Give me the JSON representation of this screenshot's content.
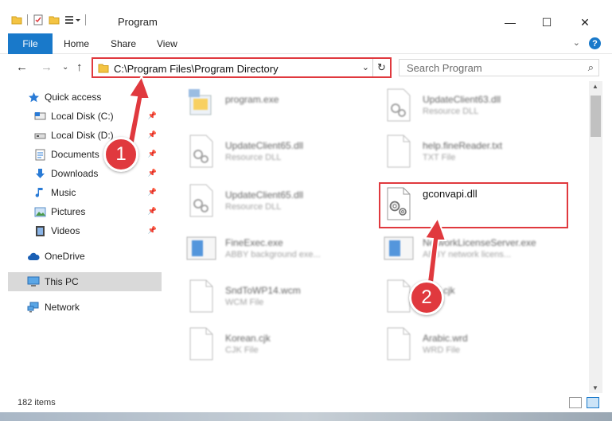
{
  "window": {
    "title": "Program",
    "minimize": "—",
    "maximize": "☐",
    "close": "✕"
  },
  "ribbon": {
    "file_label": "File",
    "tabs": [
      "Home",
      "Share",
      "View"
    ],
    "help": "?"
  },
  "address": {
    "path": "C:\\Program Files\\Program Directory"
  },
  "search": {
    "placeholder": "Search Program"
  },
  "sidebar": {
    "items": [
      {
        "label": "Quick access"
      },
      {
        "label": "Local Disk (C:)"
      },
      {
        "label": "Local Disk (D:)"
      },
      {
        "label": "Documents"
      },
      {
        "label": "Downloads"
      },
      {
        "label": "Music"
      },
      {
        "label": "Pictures"
      },
      {
        "label": "Videos"
      },
      {
        "label": "OneDrive"
      },
      {
        "label": "This PC"
      },
      {
        "label": "Network"
      }
    ]
  },
  "files": {
    "left": [
      {
        "name": "program.exe",
        "type": ""
      },
      {
        "name": "UpdateClient65.dll",
        "type": "Resource DLL"
      },
      {
        "name": "UpdateClient65.dll",
        "type": "Resource DLL"
      },
      {
        "name": "FineExec.exe",
        "type": "ABBY background exe..."
      },
      {
        "name": "SndToWP14.wcm",
        "type": "WCM File"
      },
      {
        "name": "Korean.cjk",
        "type": "CJK File"
      }
    ],
    "right": [
      {
        "name": "UpdateClient63.dll",
        "type": "Resource DLL"
      },
      {
        "name": "help.fineReader.txt",
        "type": "TXT File"
      },
      {
        "name": "gconvapi.dll",
        "type": ""
      },
      {
        "name": "NetworkLicenseServer.exe",
        "type": "ABBY network licens..."
      },
      {
        "name": "...ml.cjk",
        "type": "...File"
      },
      {
        "name": "Arabic.wrd",
        "type": "WRD File"
      }
    ]
  },
  "status": {
    "item_count": "182 items"
  },
  "annotations": {
    "step1": "1",
    "step2": "2",
    "color": "#e0393e"
  },
  "colors": {
    "accent": "#1979ca",
    "highlight": "#e0393e"
  }
}
